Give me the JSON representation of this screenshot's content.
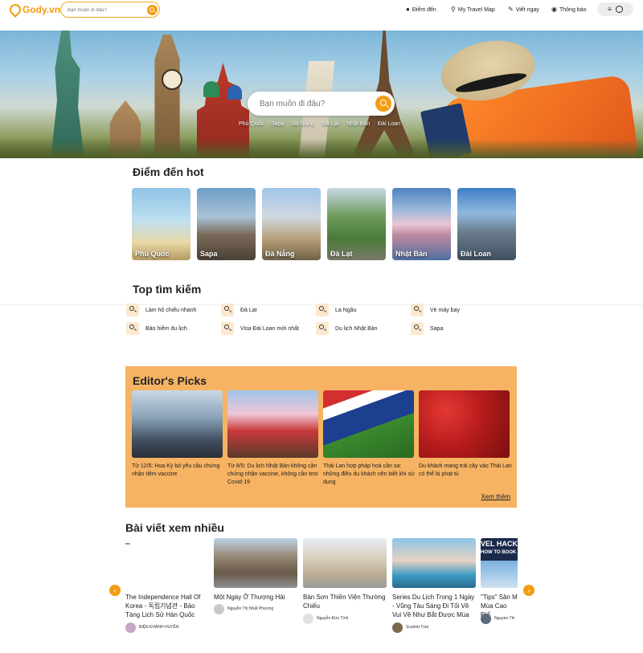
{
  "header": {
    "logo": "Gody.vn",
    "search_placeholder": "Bạn muốn đi đâu?",
    "nav": [
      {
        "label": "Điểm đến",
        "icon": "globe-icon"
      },
      {
        "label": "My Travel Map",
        "icon": "map-pin-icon"
      },
      {
        "label": "Viết ngay",
        "icon": "pencil-icon"
      },
      {
        "label": "Thông báo",
        "icon": "bell-icon"
      }
    ]
  },
  "hero": {
    "search_placeholder": "Bạn muốn đi đâu?",
    "quick_links": [
      "Phú Quốc",
      "Sapa",
      "Đà Nẵng",
      "Đà Lạt",
      "Nhật Bản",
      "Đài Loan"
    ]
  },
  "hot": {
    "title": "Điểm đến hot",
    "items": [
      "Phú Quốc",
      "Sapa",
      "Đà Nẵng",
      "Đà Lạt",
      "Nhật Bản",
      "Đài Loan"
    ]
  },
  "top_search": {
    "title": "Top tìm kiếm",
    "items": [
      "Làm hộ chiếu nhanh",
      "Đà Lạt",
      "La Ngâu",
      "Vé máy bay",
      "Bảo hiểm du lịch",
      "Visa Đài Loan mới nhất",
      "Du lịch Nhật Bản",
      "Sapa"
    ]
  },
  "picks": {
    "title": "Editor's Picks",
    "more": "Xem thêm",
    "items": [
      "Từ 12/5: Hoa Kỳ bỏ yêu cầu chứng nhận tiêm vaccine",
      "Từ 8/5: Du lịch Nhật Bản không cần chứng nhận vaccine, không cần test Covid-19",
      "Thái Lan hợp pháp hoá cần sa: những điều du khách nên biết khi sử dụng",
      "Du khách mang trái cây vào Thái Lan có thể bị phạt tù"
    ]
  },
  "most_viewed": {
    "title": "Bài viết xem nhiều",
    "items": [
      {
        "title": "The Independence Hall Of Korea - 독립기념관 - Bảo Tàng Lịch Sử Hàn Quốc",
        "author": "BIỆN KHÁNH HUYỀN"
      },
      {
        "title": "Một Ngày Ở Thượng Hải",
        "author": "Nguyễn Thị Nhất Phương"
      },
      {
        "title": "Bản Sơn Thiền Viện Thường Chiếu",
        "author": "Nguyễn Đức Tính"
      },
      {
        "title": "Series Du Lịch Trong 1 Ngày - Vũng Tàu Sáng Đi Tối Về Vui Về Như Bắt Được Mùa",
        "author": "Scarlett Tran"
      },
      {
        "title": "\"Tips\" Săn M Mùa Cao Điể",
        "author": "Nguyen Thi"
      }
    ],
    "banner_text": "VEL HACK",
    "banner_sub": "HOW TO BOOK"
  },
  "colors": {
    "accent": "#f39c12",
    "picks_bg": "#f6b363",
    "icon_bg": "#fde9cf"
  }
}
